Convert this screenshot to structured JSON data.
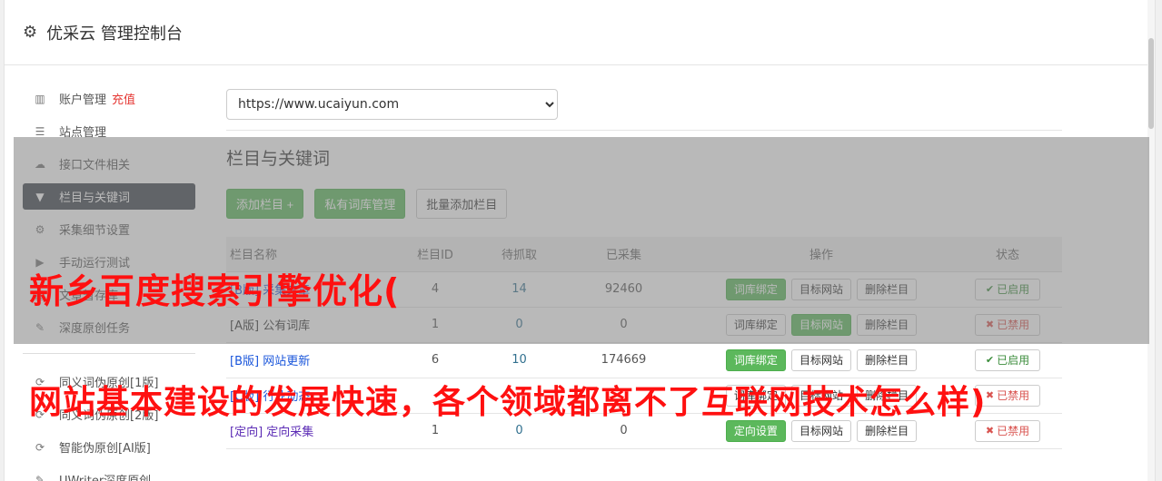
{
  "app": {
    "title": "优采云 管理控制台"
  },
  "sidebar": {
    "items": [
      {
        "icon": "bar-chart-icon",
        "glyph": "▥",
        "label": "账户管理",
        "extra": "充值"
      },
      {
        "icon": "server-icon",
        "glyph": "☰",
        "label": "站点管理"
      },
      {
        "icon": "cloud-upload-icon",
        "glyph": "☁",
        "label": "接口文件相关"
      },
      {
        "icon": "filter-icon",
        "glyph": "▼",
        "label": "栏目与关键词",
        "active": true
      },
      {
        "icon": "gears-icon",
        "glyph": "⚙",
        "label": "采集细节设置"
      },
      {
        "icon": "play-circle-icon",
        "glyph": "▶",
        "label": "手动运行测试"
      },
      {
        "icon": "archive-icon",
        "glyph": "▤",
        "label": "文章暂存库"
      },
      {
        "icon": "edit-icon",
        "glyph": "✎",
        "label": "深度原创任务"
      }
    ],
    "items2": [
      {
        "icon": "refresh-icon",
        "glyph": "⟳",
        "label": "同义词伪原创[1版]"
      },
      {
        "icon": "refresh-icon",
        "glyph": "⟳",
        "label": "同义词伪原创[2版]"
      },
      {
        "icon": "refresh-icon",
        "glyph": "⟳",
        "label": "智能伪原创[AI版]"
      },
      {
        "icon": "edit-icon",
        "glyph": "✎",
        "label": "UWriter深度原创"
      }
    ]
  },
  "main": {
    "site_select": {
      "value": "https://www.ucaiyun.com"
    },
    "section_title": "栏目与关键词",
    "buttons": {
      "add_column": "添加栏目 +",
      "private_lexicon": "私有词库管理",
      "batch_add": "批量添加栏目"
    },
    "table": {
      "headers": {
        "name": "栏目名称",
        "id": "栏目ID",
        "pending": "待抓取",
        "collected": "已采集",
        "ops": "操作",
        "status": "状态"
      },
      "rows": [
        {
          "tag": "[B版]",
          "name": "采集文章",
          "id": "4",
          "pending": "14",
          "collected": "92460",
          "op1": "词库绑定",
          "op1_green": true,
          "op2": "目标网站",
          "op2_green": false,
          "op3": "删除栏目",
          "status": "已启用",
          "enabled": true
        },
        {
          "tag": "[A版]",
          "name": "公有词库",
          "id": "1",
          "pending": "0",
          "collected": "0",
          "op1": "词库绑定",
          "op1_green": false,
          "op2": "目标网站",
          "op2_green": true,
          "op3": "删除栏目",
          "status": "已禁用",
          "enabled": false
        },
        {
          "tag": "[B版]",
          "name": "网站更新",
          "id": "6",
          "pending": "10",
          "collected": "174669",
          "op1": "词库绑定",
          "op1_green": true,
          "op2": "目标网站",
          "op2_green": false,
          "op3": "删除栏目",
          "status": "已启用",
          "enabled": true
        },
        {
          "tag": "[C版]",
          "name": "行业动态",
          "id": "",
          "pending": "",
          "collected": "",
          "op1": "词库绑定",
          "op1_green": false,
          "op2": "目标网站",
          "op2_green": false,
          "op3": "删除栏目",
          "status": "已禁用",
          "enabled": false
        },
        {
          "tag": "[定向]",
          "name": "定向采集",
          "id": "1",
          "pending": "0",
          "collected": "0",
          "op1": "定向设置",
          "op1_green": true,
          "op2": "目标网站",
          "op2_green": false,
          "op3": "删除栏目",
          "status": "已禁用",
          "enabled": false
        }
      ]
    }
  },
  "captions": {
    "line1": "新乡百度搜索引擎优化(",
    "line2": "网站基本建设的发展快速，各个领域都离不了互联网技术怎么样)"
  },
  "colors": {
    "accent_green": "#5cb85c",
    "active_nav": "#3d434c",
    "caption_red": "#ff1010",
    "recharge_red": "#e53935"
  }
}
